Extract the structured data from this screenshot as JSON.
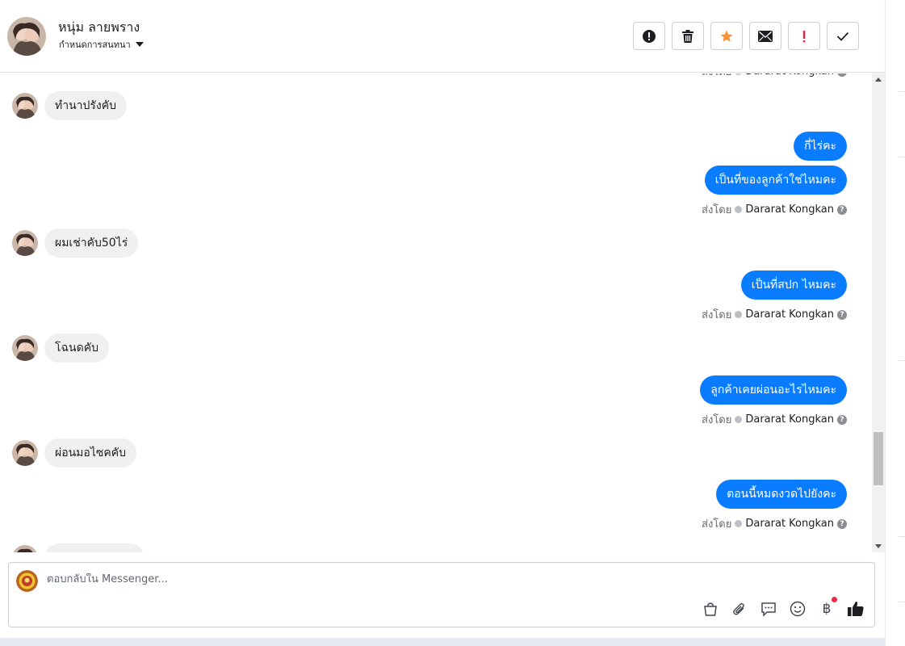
{
  "header": {
    "contact_name": "หนุ่ม ลายพราง",
    "label_button": "กำหนดการสนทนา"
  },
  "actions": [
    "spam-report",
    "delete",
    "star",
    "mark-unread",
    "important",
    "done"
  ],
  "messages": [
    {
      "dir": "in",
      "text": "ทำนาปรังคับ"
    },
    {
      "dir": "out",
      "text": "กี่ไร่คะ"
    },
    {
      "dir": "out",
      "text": "เป็นที่ของลูกค้าใช่ไหมคะ"
    },
    {
      "dir": "in",
      "text": "ผมเช่าคับ50ไร่"
    },
    {
      "dir": "out",
      "text": "เป็นที่สปก ไหมคะ"
    },
    {
      "dir": "in",
      "text": "โฉนดคับ"
    },
    {
      "dir": "out",
      "text": "ลูกค้าเคยผ่อนอะไรไหมคะ"
    },
    {
      "dir": "in",
      "text": "ผ่อนมอไซคคับ"
    },
    {
      "dir": "out",
      "text": "ตอนนี้หมดงวดไปยังคะ"
    }
  ],
  "sent_by": {
    "prefix": "ส่งโดย",
    "name": "Dararat Kongkan",
    "help": "?"
  },
  "composer": {
    "placeholder": "ตอบกลับใน Messenger..."
  },
  "tools": {
    "currency_symbol": "฿"
  },
  "colors": {
    "outgoing_bubble": "#0a7cff",
    "incoming_bubble": "#f0f0f0",
    "star": "#f7923a",
    "important": "#e41e3f",
    "notification_dot": "#f02849"
  }
}
